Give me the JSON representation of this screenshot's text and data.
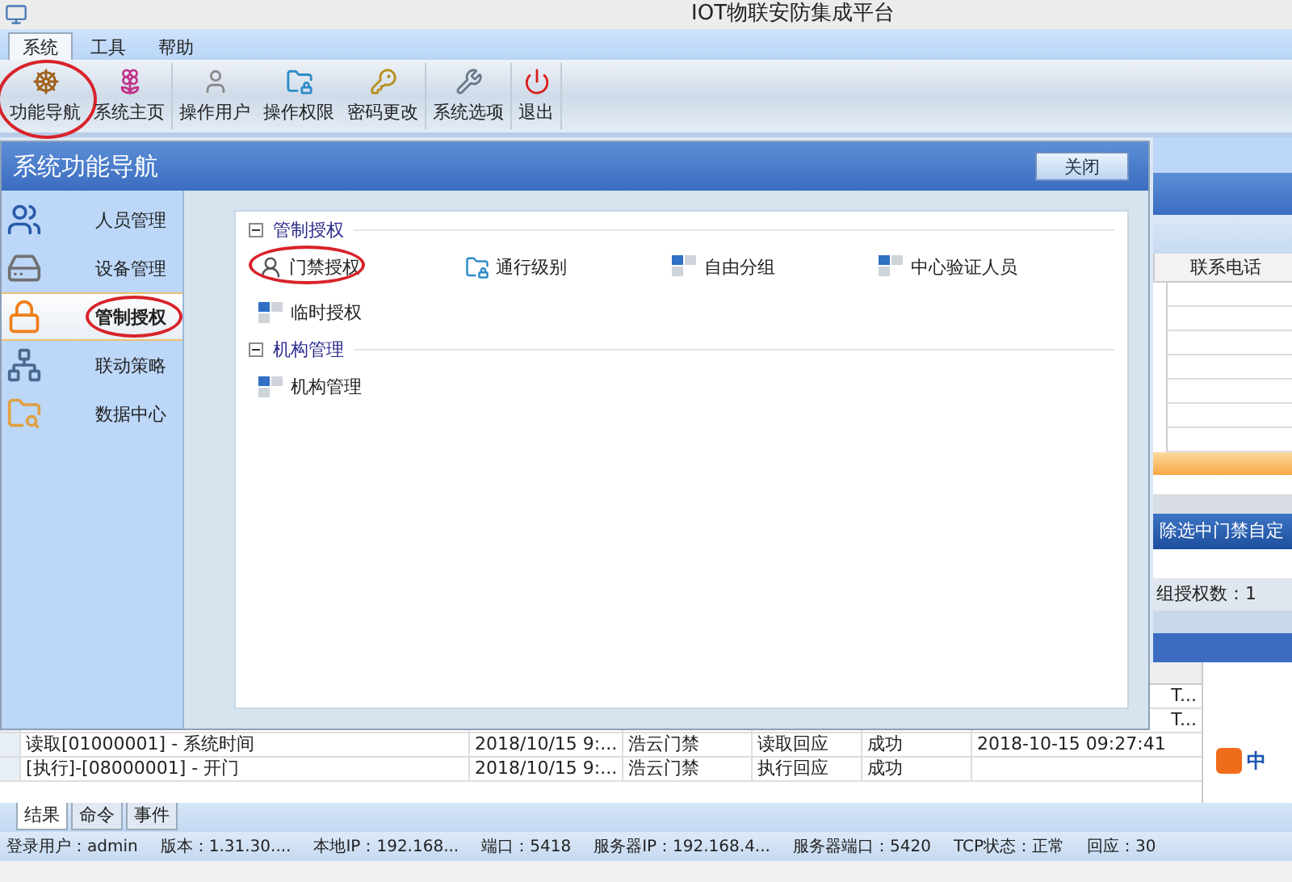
{
  "window": {
    "title": "IOT物联安防集成平台"
  },
  "menu_tabs": [
    {
      "label": "系统",
      "selected": true
    },
    {
      "label": "工具",
      "selected": false
    },
    {
      "label": "帮助",
      "selected": false
    }
  ],
  "toolbar": [
    {
      "label": "功能导航",
      "circled": true
    },
    {
      "label": "系统主页",
      "circled": false
    },
    {
      "label": "操作用户",
      "circled": false
    },
    {
      "label": "操作权限",
      "circled": false
    },
    {
      "label": "密码更改",
      "circled": false
    },
    {
      "label": "系统选项",
      "circled": false
    },
    {
      "label": "退出",
      "circled": false
    }
  ],
  "background_panel": {
    "column_header": "联系电话",
    "action_bar": "除选中门禁自定",
    "count_label": "组授权数：1"
  },
  "log_table": {
    "rows": [
      {
        "message": "",
        "time": "",
        "source": "",
        "type": "",
        "result": "",
        "time2": "T..."
      },
      {
        "message": "",
        "time": "",
        "source": "",
        "type": "",
        "result": "",
        "time2": "T..."
      },
      {
        "message": "读取[01000001] - 系统时间",
        "time": "2018/10/15 9:...",
        "source": "浩云门禁",
        "type": "读取回应",
        "result": "成功",
        "time2": "2018-10-15 09:27:41"
      },
      {
        "message": "[执行]-[08000001] - 开门",
        "time": "2018/10/15 9:...",
        "source": "浩云门禁",
        "type": "执行回应",
        "result": "成功",
        "time2": ""
      }
    ]
  },
  "bottom_tabs": [
    {
      "label": "结果",
      "selected": true
    },
    {
      "label": "命令",
      "selected": false
    },
    {
      "label": "事件",
      "selected": false
    }
  ],
  "ime_indicator": "中",
  "status_bar": [
    "登录用户：admin",
    "版本：1.31.30....",
    "本地IP：192.168...",
    "端口：5418",
    "服务器IP：192.168.4...",
    "服务器端口：5420",
    "TCP状态：正常",
    "回应：30"
  ],
  "dialog": {
    "title": "系统功能导航",
    "close_button": "关闭",
    "sidebar": [
      {
        "label": "人员管理",
        "selected": false,
        "circled": false
      },
      {
        "label": "设备管理",
        "selected": false,
        "circled": false
      },
      {
        "label": "管制授权",
        "selected": true,
        "circled": true
      },
      {
        "label": "联动策略",
        "selected": false,
        "circled": false
      },
      {
        "label": "数据中心",
        "selected": false,
        "circled": false
      }
    ],
    "groups": [
      {
        "title": "管制授权",
        "expanded": true,
        "items": [
          {
            "label": "门禁授权",
            "circled": true
          },
          {
            "label": "通行级别",
            "circled": false
          },
          {
            "label": "自由分组",
            "circled": false
          },
          {
            "label": "中心验证人员",
            "circled": false
          },
          {
            "label": "临时授权",
            "circled": false
          }
        ]
      },
      {
        "title": "机构管理",
        "expanded": true,
        "items": [
          {
            "label": "机构管理",
            "circled": false
          }
        ]
      }
    ]
  }
}
